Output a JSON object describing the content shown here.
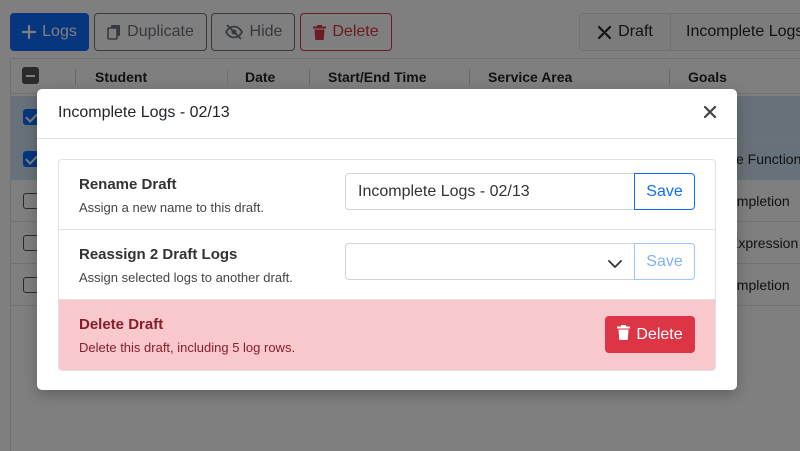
{
  "toolbar": {
    "add_logs_label": "Logs",
    "duplicate_label": "Duplicate",
    "hide_label": "Hide",
    "delete_label": "Delete",
    "draft_label": "Draft",
    "draft_name_label": "Incomplete Logs"
  },
  "grid": {
    "columns": [
      "Student",
      "Date",
      "Start/End Time",
      "Service Area",
      "Goals"
    ],
    "rows": [
      {
        "checked": true,
        "goal": ""
      },
      {
        "checked": true,
        "goal": "ve Function"
      },
      {
        "checked": false,
        "goal": "ompletion"
      },
      {
        "checked": false,
        "goal": "Expression"
      },
      {
        "checked": false,
        "goal": "ompletion"
      }
    ]
  },
  "modal": {
    "title": "Incomplete Logs - 02/13",
    "rename": {
      "title": "Rename Draft",
      "description": "Assign a new name to this draft.",
      "value": "Incomplete Logs - 02/13",
      "save_label": "Save"
    },
    "reassign": {
      "title": "Reassign 2 Draft Logs",
      "description": "Assign selected logs to another draft.",
      "selected": "",
      "save_label": "Save"
    },
    "delete": {
      "title": "Delete Draft",
      "description": "Delete this draft, including 5 log rows.",
      "button_label": "Delete"
    }
  },
  "colors": {
    "primary": "#0d6efd",
    "danger": "#dc3545",
    "danger_bg": "#f8c8cc",
    "selected_row": "#cfe2f3"
  }
}
